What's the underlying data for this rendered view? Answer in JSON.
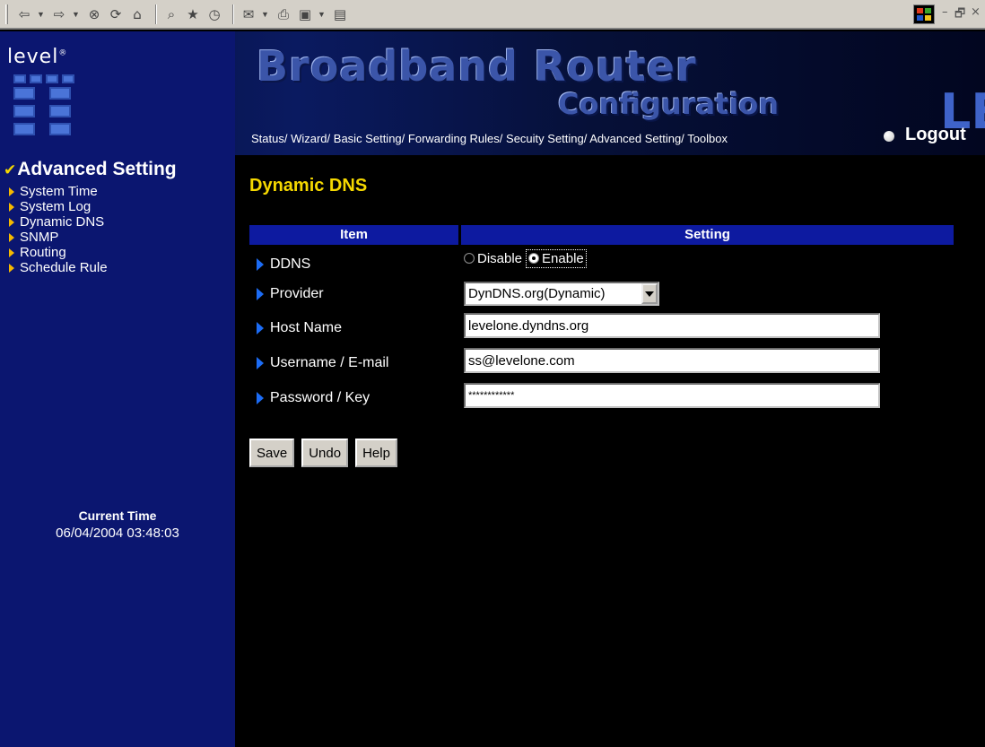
{
  "toolbar": {
    "icons": [
      "back-icon",
      "forward-icon",
      "stop-icon",
      "refresh-icon",
      "home-icon",
      "search-icon",
      "favorites-icon",
      "history-icon",
      "mail-icon",
      "print-icon",
      "edit-icon",
      "discuss-icon"
    ],
    "window_controls": {
      "minimize": "–",
      "restore": "🗗",
      "close": "×"
    }
  },
  "header": {
    "logo_text": "level",
    "logo_sup": "®",
    "brand_title": "Broadband Router",
    "brand_subtitle": "Configuration",
    "brand_mark": "LE",
    "nav": [
      "Status/",
      "Wizard/",
      "Basic Setting/",
      "Forwarding Rules/",
      "Secuity Setting/",
      "Advanced Setting/",
      "Toolbox"
    ],
    "logout": "Logout"
  },
  "sidebar": {
    "title": "Advanced Setting",
    "items": [
      "System Time",
      "System Log",
      "Dynamic DNS",
      "SNMP",
      "Routing",
      "Schedule Rule"
    ],
    "current_time_label": "Current Time",
    "current_time_value": "06/04/2004 03:48:03"
  },
  "main": {
    "title": "Dynamic DNS",
    "table_headers": {
      "item": "Item",
      "setting": "Setting"
    },
    "rows": {
      "ddns": {
        "label": "DDNS",
        "option_disable": "Disable",
        "option_enable": "Enable",
        "selected": "Enable"
      },
      "provider": {
        "label": "Provider",
        "value": "DynDNS.org(Dynamic)"
      },
      "host": {
        "label": "Host Name",
        "value": "levelone.dyndns.org"
      },
      "user": {
        "label": "Username / E-mail",
        "value": "ss@levelone.com"
      },
      "password": {
        "label": "Password / Key",
        "value": "************"
      }
    },
    "buttons": {
      "save": "Save",
      "undo": "Undo",
      "help": "Help"
    }
  },
  "colors": {
    "sidebar_bg": "#0b1670",
    "header_bar": "#0d1aa0",
    "title_yellow": "#f5d800",
    "arrow_blue": "#1c6cf5"
  }
}
